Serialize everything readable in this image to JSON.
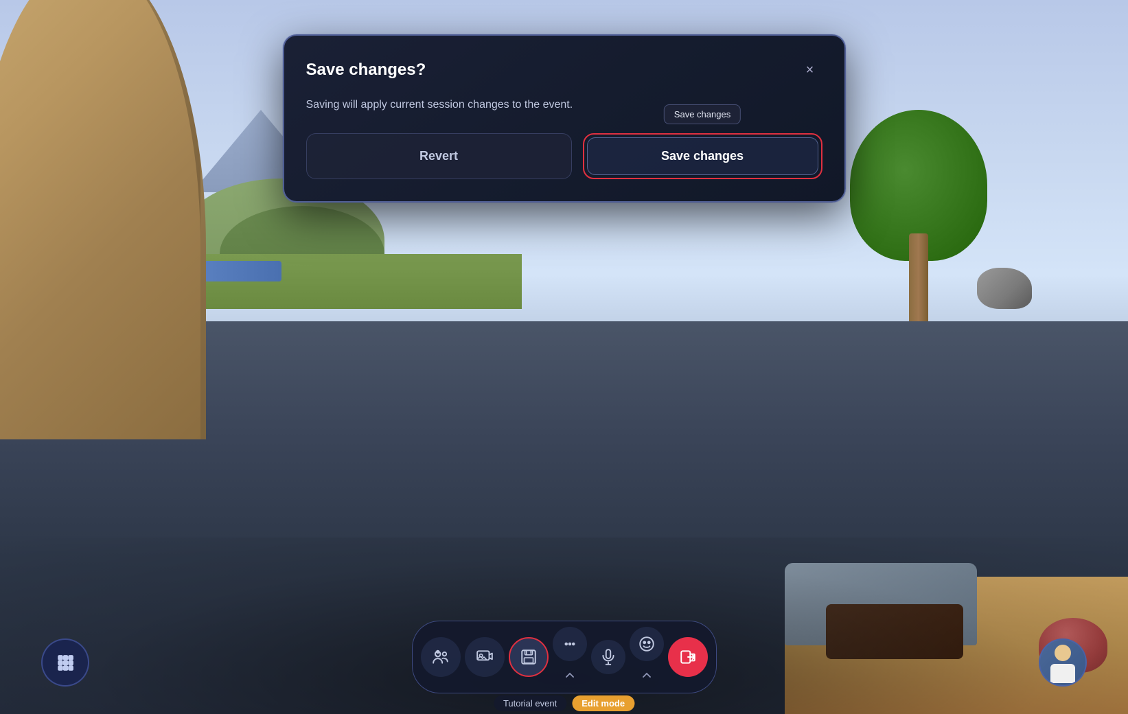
{
  "background": {
    "sky_color_top": "#b8c8e8",
    "sky_color_bottom": "#a8b8d0",
    "ground_color": "#3a4458"
  },
  "modal": {
    "title": "Save changes?",
    "description": "Saving will apply current session changes to\nthe event.",
    "close_label": "×",
    "revert_label": "Revert",
    "save_label": "Save changes",
    "tooltip_label": "Save changes"
  },
  "toolbar": {
    "items": [
      {
        "id": "people",
        "label": "People",
        "icon": "people"
      },
      {
        "id": "media",
        "label": "Media",
        "icon": "media"
      },
      {
        "id": "save",
        "label": "Save",
        "icon": "save",
        "highlighted": true
      },
      {
        "id": "more",
        "label": "More",
        "icon": "more"
      },
      {
        "id": "mic",
        "label": "Microphone",
        "icon": "mic"
      },
      {
        "id": "emoji",
        "label": "Emoji",
        "icon": "emoji"
      },
      {
        "id": "leave",
        "label": "Leave",
        "icon": "leave",
        "red": true
      }
    ],
    "caret_more": "^",
    "caret_emoji": "^"
  },
  "status": {
    "event_label": "Tutorial event",
    "mode_label": "Edit mode"
  },
  "left_menu": {
    "icon": "grid",
    "label": "Menu"
  },
  "right_avatar": {
    "label": "User avatar"
  }
}
